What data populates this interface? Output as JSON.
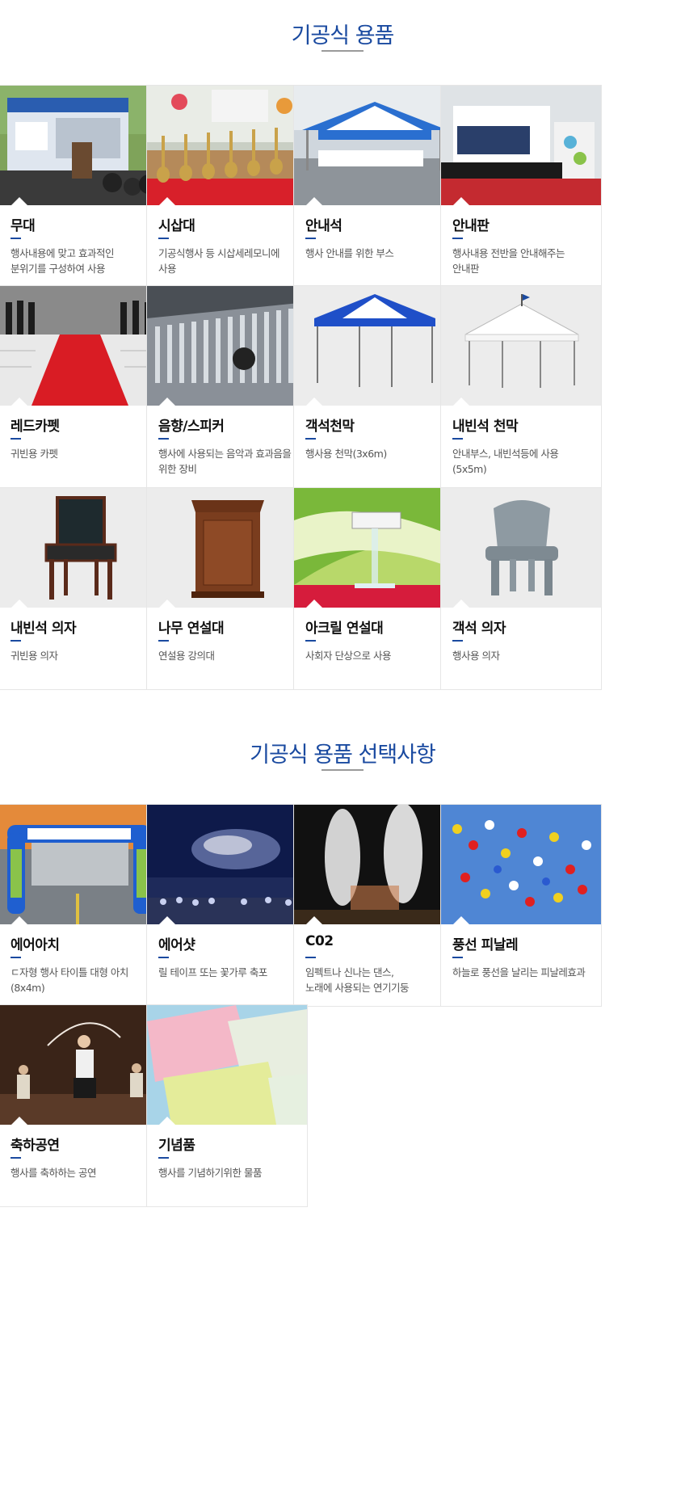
{
  "sections": [
    {
      "title": "기공식 용품",
      "items": [
        {
          "name": "무대",
          "desc": "행사내용에 맞고 효과적인\n분위기를 구성하여 사용",
          "image": "stage-photo"
        },
        {
          "name": "시삽대",
          "desc": "기공식행사 등 시삽세레모니에\n사용",
          "image": "shovel-stand-photo"
        },
        {
          "name": "안내석",
          "desc": "행사 안내를 위한 부스",
          "image": "info-booth-photo"
        },
        {
          "name": "안내판",
          "desc": "행사내용 전반을 안내해주는\n안내판",
          "image": "info-board-photo"
        },
        {
          "name": "레드카펫",
          "desc": "귀빈용 카펫",
          "image": "red-carpet-photo"
        },
        {
          "name": "음향/스피커",
          "desc": "행사에 사용되는 음악과 효과음을\n위한 장비",
          "image": "mixer-photo"
        },
        {
          "name": "객석천막",
          "desc": "행사용 천막(3x6m)",
          "image": "blue-tent-photo"
        },
        {
          "name": "내빈석 천막",
          "desc": "안내부스, 내빈석등에 사용\n(5x5m)",
          "image": "white-tent-photo"
        },
        {
          "name": "내빈석 의자",
          "desc": "귀빈용 의자",
          "image": "vip-chair-photo"
        },
        {
          "name": "나무 연설대",
          "desc": "연설용 강의대",
          "image": "wood-podium-photo"
        },
        {
          "name": "아크릴 연설대",
          "desc": "사회자 단상으로 사용",
          "image": "acrylic-podium-photo"
        },
        {
          "name": "객석 의자",
          "desc": "행사용 의자",
          "image": "plastic-chair-photo"
        }
      ]
    },
    {
      "title": "기공식 용품 선택사항",
      "items": [
        {
          "name": "에어아치",
          "desc": "ㄷ자형 행사 타이틀 대형 아치\n(8x4m)",
          "image": "air-arch-photo"
        },
        {
          "name": "에어샷",
          "desc": "릴 테이프 또는 꽃가루 축포",
          "image": "air-shot-photo"
        },
        {
          "name": "C02",
          "desc": "임펙트나 신나는 댄스,\n노래에 사용되는 연기기둥",
          "image": "co2-smoke-photo"
        },
        {
          "name": "풍선 피날레",
          "desc": "하늘로 풍선을 날리는 피날레효과",
          "image": "balloon-photo"
        },
        {
          "name": "축하공연",
          "desc": "행사를 축하하는 공연",
          "image": "performance-photo"
        },
        {
          "name": "기념품",
          "desc": "행사를 기념하기위한 물품",
          "image": "towel-gift-photo"
        }
      ]
    }
  ],
  "colors": {
    "accent": "#1a4aa0",
    "border": "#e6e6e6"
  }
}
